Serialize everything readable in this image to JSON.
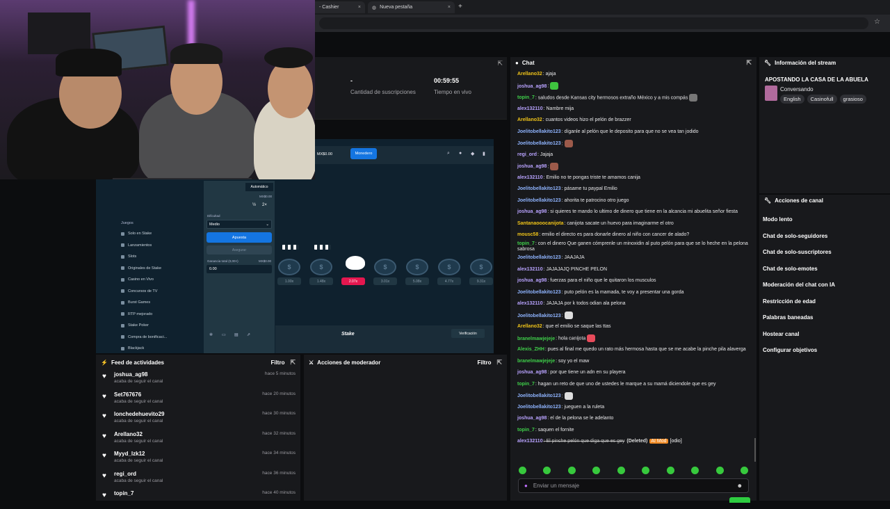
{
  "browser": {
    "tabs": [
      {
        "label": "- Cashier",
        "close": "×"
      },
      {
        "label": "Nueva pestaña",
        "close": "×"
      }
    ],
    "new_tab": "+",
    "star": "☆"
  },
  "stats": [
    {
      "value": "-",
      "label": "Cantidad de suscripciones"
    },
    {
      "value": "00:59:55",
      "label": "Tiempo en vivo"
    }
  ],
  "game": {
    "balance": "MX$0.00",
    "wallet_label": "Monedero",
    "auto_label": "Automático",
    "bet_value": "MX$0.00",
    "half": "½",
    "double": "2×",
    "difficulty_label": "Dificultad",
    "difficulty_value": "Medio",
    "bet_button": "Apuesta",
    "cashout_button": "Asegurar",
    "profit_label": "Ganancia total (0,00×)",
    "profit_currency": "MX$0.00",
    "profit_value": "0.00",
    "section": "Juegos",
    "sidebar": [
      "Solo en Stake",
      "Lanzamientos",
      "Slots",
      "Originales de Stake",
      "Casino en Vivo",
      "Concursos de TV",
      "Burst Games",
      "RTP mejorado",
      "Stake Poker",
      "Compra de bonificaci...",
      "Blackjack"
    ],
    "multipliers": [
      "1.00x",
      "1.48x",
      "2.07x",
      "3.01x",
      "5.08x",
      "4.77x",
      "9.31x"
    ],
    "logo": "Stake",
    "verify": "Verificación"
  },
  "feed": {
    "title": "Feed de actividades",
    "filter": "Filtro",
    "items": [
      {
        "user": "joshua_ag98",
        "action": "acaba de seguir el canal",
        "time": "hace 5 minutos"
      },
      {
        "user": "Set767676",
        "action": "acaba de seguir el canal",
        "time": "hace 20 minutos"
      },
      {
        "user": "lonchedehuevito29",
        "action": "acaba de seguir el canal",
        "time": "hace 30 minutos"
      },
      {
        "user": "Arellano32",
        "action": "acaba de seguir el canal",
        "time": "hace 32 minutos"
      },
      {
        "user": "Myyd_lzk12",
        "action": "acaba de seguir el canal",
        "time": "hace 34 minutos"
      },
      {
        "user": "regi_ord",
        "action": "acaba de seguir el canal",
        "time": "hace 36 minutos"
      },
      {
        "user": "topin_7",
        "action": "",
        "time": "hace 40 minutos"
      }
    ]
  },
  "mod": {
    "title": "Acciones de moderador",
    "filter": "Filtro"
  },
  "chat": {
    "title": "Chat",
    "input_placeholder": "Enviar un mensaje",
    "messages": [
      {
        "user": "Arellano32",
        "color": "#f0c419",
        "text": ": ajaja"
      },
      {
        "user": "joshua_ag98",
        "color": "#b9a3ff",
        "text": ":",
        "emote": "#3fc43f"
      },
      {
        "user": "topin_7",
        "color": "#3fd04a",
        "text": ": saludos desde Kansas city hermosos extraño México y a mis compás",
        "emote": "#777"
      },
      {
        "user": "alex132110",
        "color": "#b9a3ff",
        "text": ": Nambre mija"
      },
      {
        "user": "Arellano32",
        "color": "#f0c419",
        "text": ": cuantos videos hizo el pelón de brazzer"
      },
      {
        "user": "Joelitobellakito123",
        "color": "#8fb4ff",
        "text": ": díganle al pelón que le deposito para que no se vea tan jodido"
      },
      {
        "user": "Joelitobellakito123",
        "color": "#8fb4ff",
        "text": ":",
        "emote": "#9c5a4a"
      },
      {
        "user": "regi_ord",
        "color": "#b9a3ff",
        "text": ": Jajaja"
      },
      {
        "user": "joshua_ag98",
        "color": "#b9a3ff",
        "text": ":",
        "emote": "#9c5a4a"
      },
      {
        "user": "alex132110",
        "color": "#b9a3ff",
        "text": ": Emilio no te pongas triste te amamos canija"
      },
      {
        "user": "Joelitobellakito123",
        "color": "#8fb4ff",
        "text": ": pásame tu paypal Emilio"
      },
      {
        "user": "Joelitobellakito123",
        "color": "#8fb4ff",
        "text": ": ahorita te patrocino otro juego"
      },
      {
        "user": "joshua_ag98",
        "color": "#b9a3ff",
        "text": ": si quieres te mando lo ultimo de dinero que tiene en la alcancia mi abuelita señor fiesta"
      },
      {
        "user": "Santanaooocanijota",
        "color": "#f0c419",
        "text": ": canijota sacate un huevo para imaginarme el otro"
      },
      {
        "user": "mousc58",
        "color": "#f0c419",
        "text": ": emilio el directo es para donarle dinero al niño con cancer de alado?"
      },
      {
        "user": "topin_7",
        "color": "#3fd04a",
        "text": ": con el dinero Que ganen cómprenle un minoxidin al puto pelón para que se lo heche en la pelona sabrosa"
      },
      {
        "user": "Joelitobellakito123",
        "color": "#8fb4ff",
        "text": ": JAAJAJA"
      },
      {
        "user": "alex132110",
        "color": "#b9a3ff",
        "text": ": JAJAJAJQ PINCHE PELON"
      },
      {
        "user": "joshua_ag98",
        "color": "#b9a3ff",
        "text": ": fuerzas para el niño que le quitaron los musculos"
      },
      {
        "user": "Joelitobellakito123",
        "color": "#8fb4ff",
        "text": ": puto pelón es la mamada, te voy a presentar una gorda"
      },
      {
        "user": "alex132110",
        "color": "#b9a3ff",
        "text": ": JAJAJA por k todos odian ala pelona"
      },
      {
        "user": "Joelitobellakito123",
        "color": "#8fb4ff",
        "text": ":",
        "emote": "#ddd"
      },
      {
        "user": "Arellano32",
        "color": "#f0c419",
        "text": ": que el emilio se saque las ttas"
      },
      {
        "user": "branelmawjejeje",
        "color": "#3fd04a",
        "text": ": hola canijota",
        "emote": "#e84b5b"
      },
      {
        "user": "Alexis_ZHH",
        "color": "#3fd04a",
        "text": ": pues al final me quedo un rato más hermosa hasta que se me acabe la pinche pila alaverga"
      },
      {
        "user": "branelmawjejeje",
        "color": "#3fd04a",
        "text": ": soy yo el maw"
      },
      {
        "user": "joshua_ag98",
        "color": "#b9a3ff",
        "text": ": por que tiene un adn en su playera"
      },
      {
        "user": "topin_7",
        "color": "#3fd04a",
        "text": ": hagan un reto de que uno de ustedes le marque a su mamá diciendole que es gey"
      },
      {
        "user": "Joelitobellakito123",
        "color": "#8fb4ff",
        "text": ":",
        "emote": "#ddd"
      },
      {
        "user": "Joelitobellakito123",
        "color": "#8fb4ff",
        "text": ": jueguen a la ruleta"
      },
      {
        "user": "joshua_ag98",
        "color": "#b9a3ff",
        "text": ": el de la pelona se le adelanto"
      },
      {
        "user": "topin_7",
        "color": "#3fd04a",
        "text": ": saquen el fornite"
      },
      {
        "user": "alex132110",
        "color": "#b9a3ff",
        "text": ": El pinche pelón que diga que es gey",
        "deleted": "(Deleted)",
        "badge": "AI Mod",
        "extra": "[odio]"
      }
    ]
  },
  "info": {
    "title": "Información del stream",
    "stream_title": "APOSTANDO LA CASA DE LA ABUELA",
    "category": "Conversando",
    "tags": [
      "English",
      "Casinofull",
      "grasioso"
    ]
  },
  "actions": {
    "title": "Acciones de canal",
    "items": [
      "Modo lento",
      "Chat de solo-seguidores",
      "Chat de solo-suscriptores",
      "Chat de solo-emotes",
      "Moderación del chat con IA",
      "Restricción de edad",
      "Palabras baneadas",
      "Hostear canal",
      "Configurar objetivos"
    ]
  },
  "colors": {
    "accent_green": "#2ecc40",
    "stake_blue": "#1475e1",
    "hot_red": "#e4174f"
  }
}
